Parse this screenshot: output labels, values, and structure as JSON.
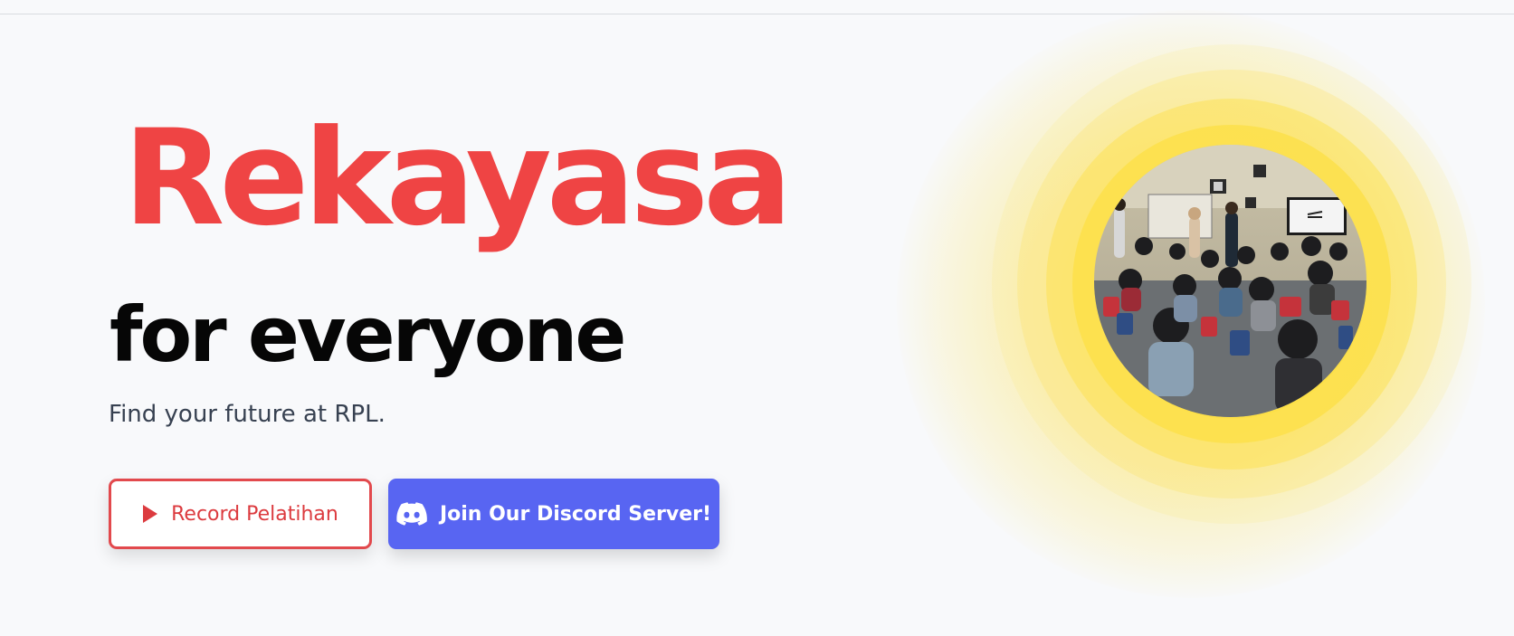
{
  "hero": {
    "title": "Rekayasa",
    "subtitle": "for everyone",
    "tagline": "Find your future at RPL."
  },
  "buttons": {
    "record_label": "Record Pelatihan",
    "discord_label": "Join Our Discord Server!"
  },
  "icons": {
    "record": "play-icon",
    "discord": "discord-icon"
  },
  "image": {
    "alt": "classroom-photo"
  },
  "colors": {
    "accent_red": "#ef4444",
    "discord_blurple": "#5865f2",
    "halo_yellow": "#fde047",
    "background": "#f8f9fb"
  }
}
